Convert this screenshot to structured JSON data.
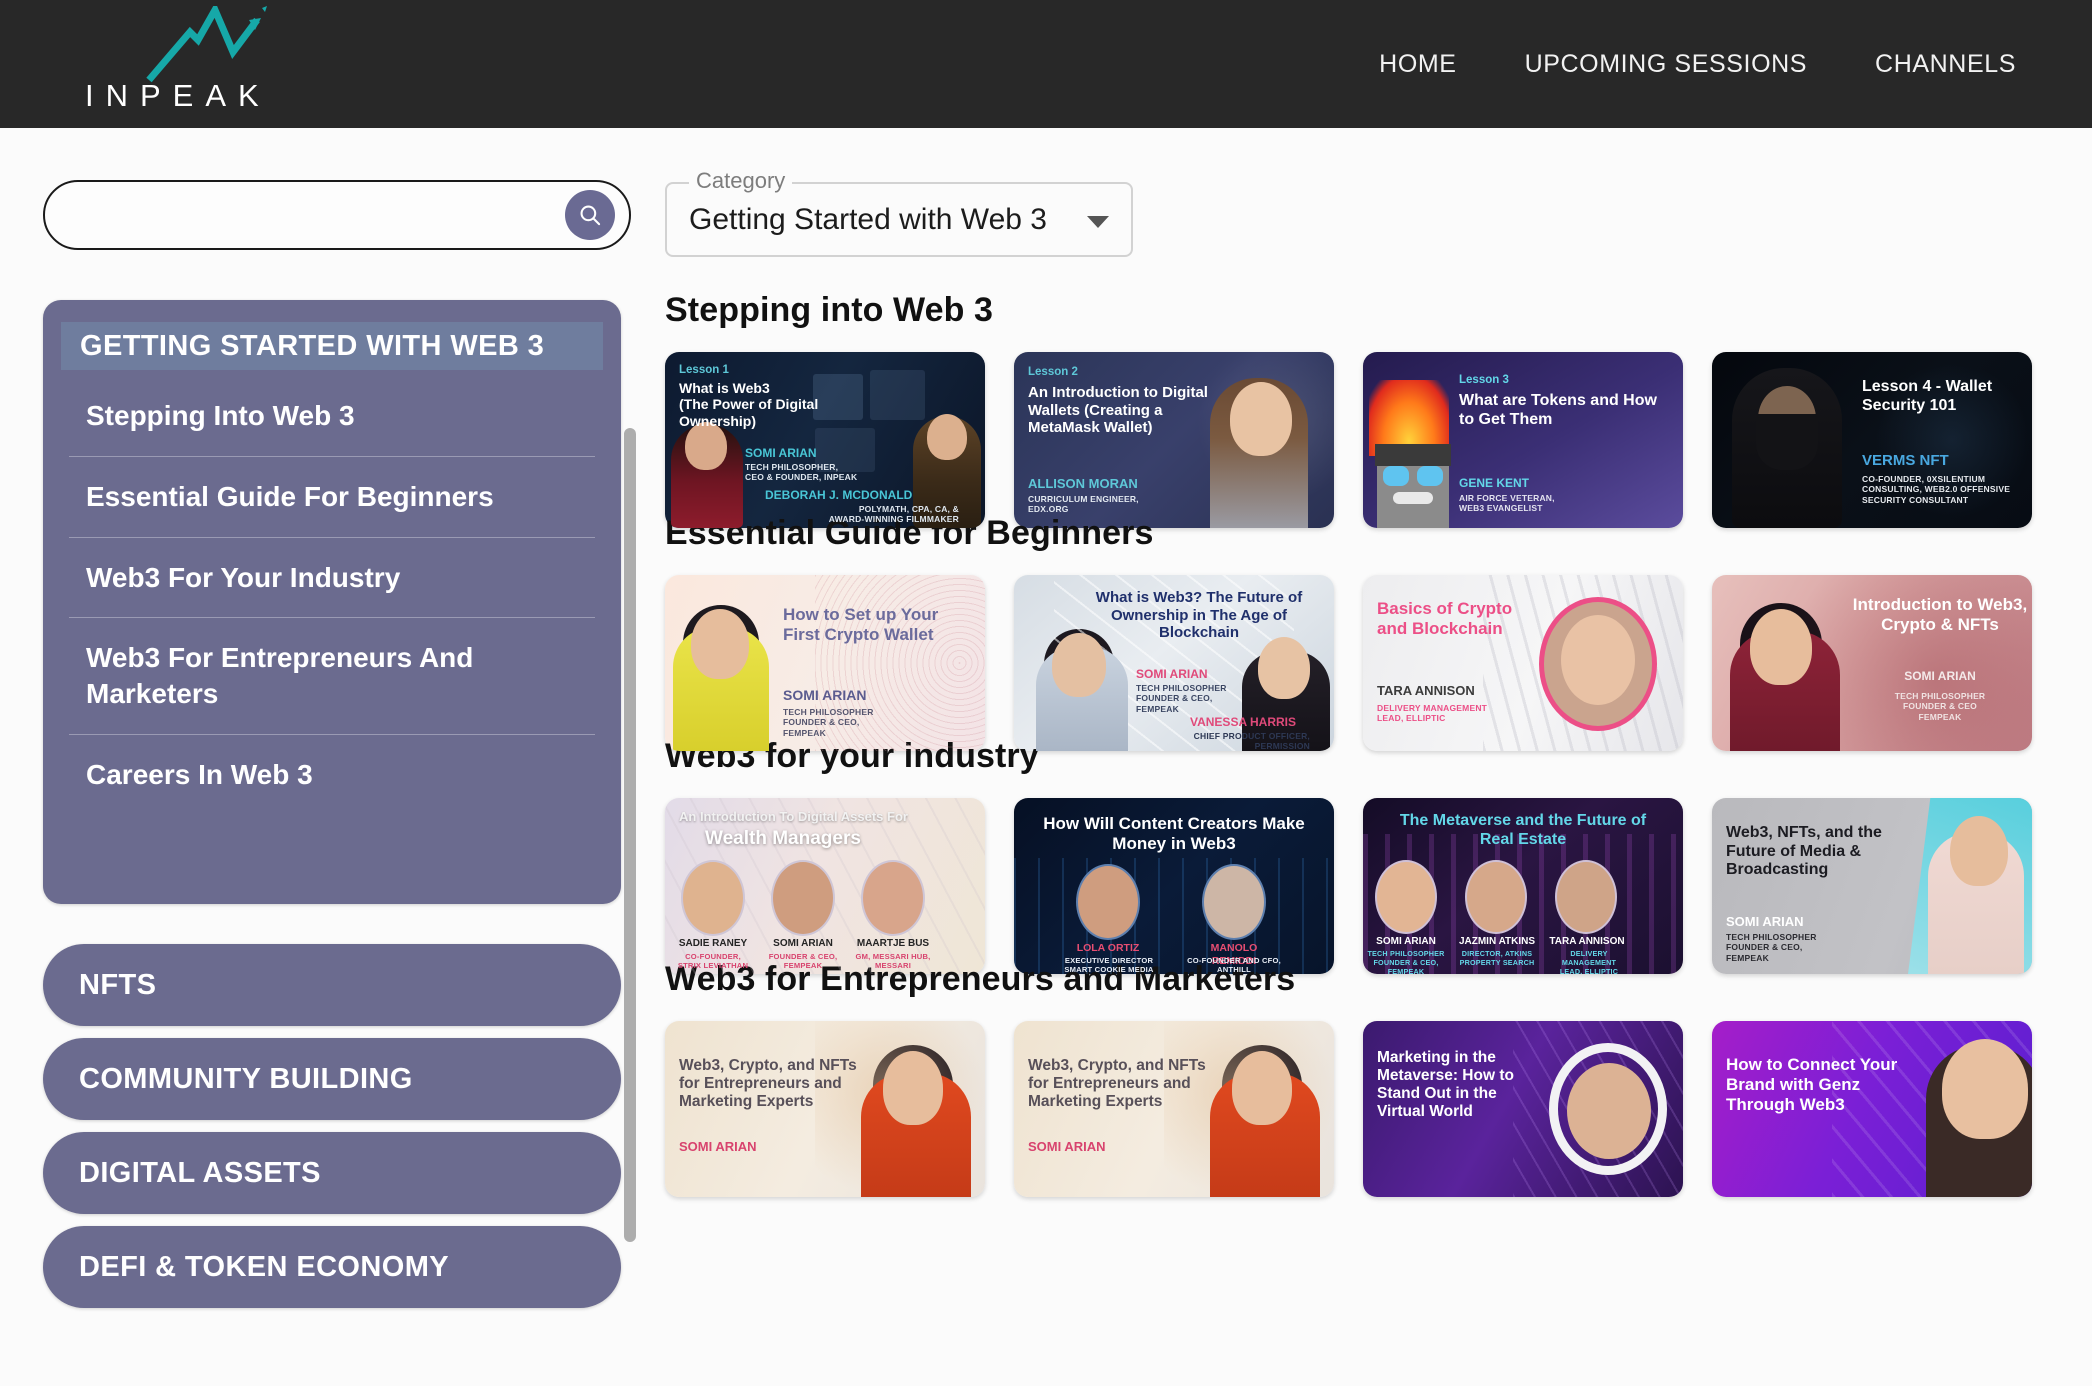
{
  "brand": {
    "name": "INPEAK",
    "logo_icon": "peak-chart-logo",
    "logo_color": "#16a8a8",
    "bar_bg": "#282828"
  },
  "nav": {
    "items": [
      {
        "label": "HOME",
        "name": "nav-home"
      },
      {
        "label": "UPCOMING SESSIONS",
        "name": "nav-upcoming-sessions"
      },
      {
        "label": "CHANNELS",
        "name": "nav-channels"
      }
    ]
  },
  "search": {
    "value": "",
    "placeholder": "",
    "button_icon": "search-icon",
    "button_color": "#6a6a93"
  },
  "category_select": {
    "legend": "Category",
    "value": "Getting Started with Web 3",
    "caret_icon": "chevron-down-icon"
  },
  "sidebar": {
    "accent": "#6b6b8f",
    "active_accent": "#6f7d9e",
    "active_group": {
      "label": "GETTING STARTED WITH WEB 3",
      "items": [
        "Stepping Into Web 3",
        "Essential Guide For Beginners",
        "Web3 For Your Industry",
        "Web3 For Entrepreneurs And Marketers",
        "Careers In Web 3"
      ]
    },
    "groups": [
      "NFTS",
      "COMMUNITY BUILDING",
      "DIGITAL ASSETS",
      "DEFI & TOKEN ECONOMY"
    ]
  },
  "sections": [
    {
      "title": "Stepping into Web 3",
      "cards": [
        {
          "eyebrow": "Lesson 1",
          "headline": "What is Web3\n(The Power of Digital Ownership)",
          "speakers": [
            {
              "name": "SOMI ARIAN",
              "role": "TECH PHILOSOPHER,\nCEO & FOUNDER, INPEAK"
            },
            {
              "name": "DEBORAH J. MCDONALD",
              "role": "POLYMATH, CPA, CA, &\nAWARD-WINNING FILMMAKER"
            }
          ]
        },
        {
          "eyebrow": "Lesson 2",
          "headline": "An Introduction to Digital Wallets (Creating a MetaMask Wallet)",
          "speakers": [
            {
              "name": "ALLISON MORAN",
              "role": "CURRICULUM ENGINEER,\nEDX.ORG"
            }
          ]
        },
        {
          "eyebrow": "Lesson 3",
          "headline": "What are Tokens and How to Get Them",
          "speakers": [
            {
              "name": "GENE KENT",
              "role": "AIR FORCE VETERAN,\nWEB3 EVANGELIST"
            }
          ]
        },
        {
          "eyebrow": "",
          "headline": "Lesson 4 - Wallet Security 101",
          "speakers": [
            {
              "name": "VERMS NFT",
              "role": "CO-FOUNDER, 0XSILENTIUM\nCONSULTING, WEB2.0 OFFENSIVE\nSECURITY CONSULTANT"
            }
          ]
        }
      ]
    },
    {
      "title": "Essential Guide for Beginners",
      "cards": [
        {
          "eyebrow": "",
          "headline": "How to Set up Your First Crypto Wallet",
          "speakers": [
            {
              "name": "SOMI ARIAN",
              "role": "TECH PHILOSOPHER\nFOUNDER & CEO,\nFEMPEAK"
            }
          ]
        },
        {
          "eyebrow": "",
          "headline": "What is Web3? The Future of Ownership in The Age of Blockchain",
          "speakers": [
            {
              "name": "SOMI ARIAN",
              "role": "TECH PHILOSOPHER\nFOUNDER & CEO,\nFEMPEAK"
            },
            {
              "name": "VANESSA HARRIS",
              "role": "CHIEF PRODUCT OFFICER,\nPERMISSION"
            }
          ]
        },
        {
          "eyebrow": "",
          "headline": "Basics of Crypto and Blockchain",
          "speakers": [
            {
              "name": "TARA ANNISON",
              "role": "DELIVERY MANAGEMENT\nLEAD, ELLIPTIC"
            }
          ]
        },
        {
          "eyebrow": "",
          "headline": "Introduction to Web3, Crypto & NFTs",
          "speakers": [
            {
              "name": "SOMI ARIAN",
              "role": "TECH PHILOSOPHER\nFOUNDER & CEO\nFEMPEAK"
            }
          ]
        }
      ]
    },
    {
      "title": "Web3 for your industry",
      "cards": [
        {
          "eyebrow": "An Introduction To Digital Assets For",
          "headline": "Wealth Managers",
          "speakers": [
            {
              "name": "SADIE RANEY",
              "role": "CO-FOUNDER,\nSTRIX LEVIATHAN"
            },
            {
              "name": "SOMI ARIAN",
              "role": "FOUNDER & CEO,\nFEMPEAK"
            },
            {
              "name": "MAARTJE BUS",
              "role": "GM, MESSARI HUB,\nMESSARI"
            }
          ]
        },
        {
          "eyebrow": "",
          "headline": "How Will Content Creators Make Money in Web3",
          "speakers": [
            {
              "name": "LOLA ORTIZ",
              "role": "EXECUTIVE DIRECTOR\nSMART COOKIE MEDIA"
            },
            {
              "name": "MANOLO REMIDDI",
              "role": "CO-FOUNDER AND CFO,\nANTHILL"
            }
          ]
        },
        {
          "eyebrow": "",
          "headline": "The Metaverse and the Future of Real Estate",
          "speakers": [
            {
              "name": "SOMI ARIAN",
              "role": "TECH PHILOSOPHER\nFOUNDER & CEO,\nFEMPEAK"
            },
            {
              "name": "JAZMIN ATKINS",
              "role": "DIRECTOR, ATKINS\nPROPERTY SEARCH"
            },
            {
              "name": "TARA ANNISON",
              "role": "DELIVERY MANAGEMENT\nLEAD, ELLIPTIC"
            }
          ]
        },
        {
          "eyebrow": "",
          "headline": "Web3, NFTs, and the Future of Media & Broadcasting",
          "speakers": [
            {
              "name": "SOMI ARIAN",
              "role": "TECH PHILOSOPHER\nFOUNDER & CEO,\nFEMPEAK"
            }
          ]
        }
      ]
    },
    {
      "title": "Web3 for Entrepreneurs and Marketers",
      "cards": [
        {
          "eyebrow": "",
          "headline": "Web3, Crypto, and NFTs for Entrepreneurs and Marketing Experts",
          "speakers": [
            {
              "name": "SOMI ARIAN",
              "role": ""
            }
          ]
        },
        {
          "eyebrow": "",
          "headline": "Web3, Crypto, and NFTs for Entrepreneurs and Marketing Experts",
          "speakers": [
            {
              "name": "SOMI ARIAN",
              "role": ""
            }
          ]
        },
        {
          "eyebrow": "",
          "headline": "Marketing in the Metaverse: How to Stand Out in the Virtual World",
          "speakers": [
            {
              "name": "",
              "role": ""
            }
          ]
        },
        {
          "eyebrow": "",
          "headline": "How to Connect Your Brand with Genz Through Web3",
          "speakers": [
            {
              "name": "",
              "role": ""
            }
          ]
        }
      ]
    }
  ]
}
